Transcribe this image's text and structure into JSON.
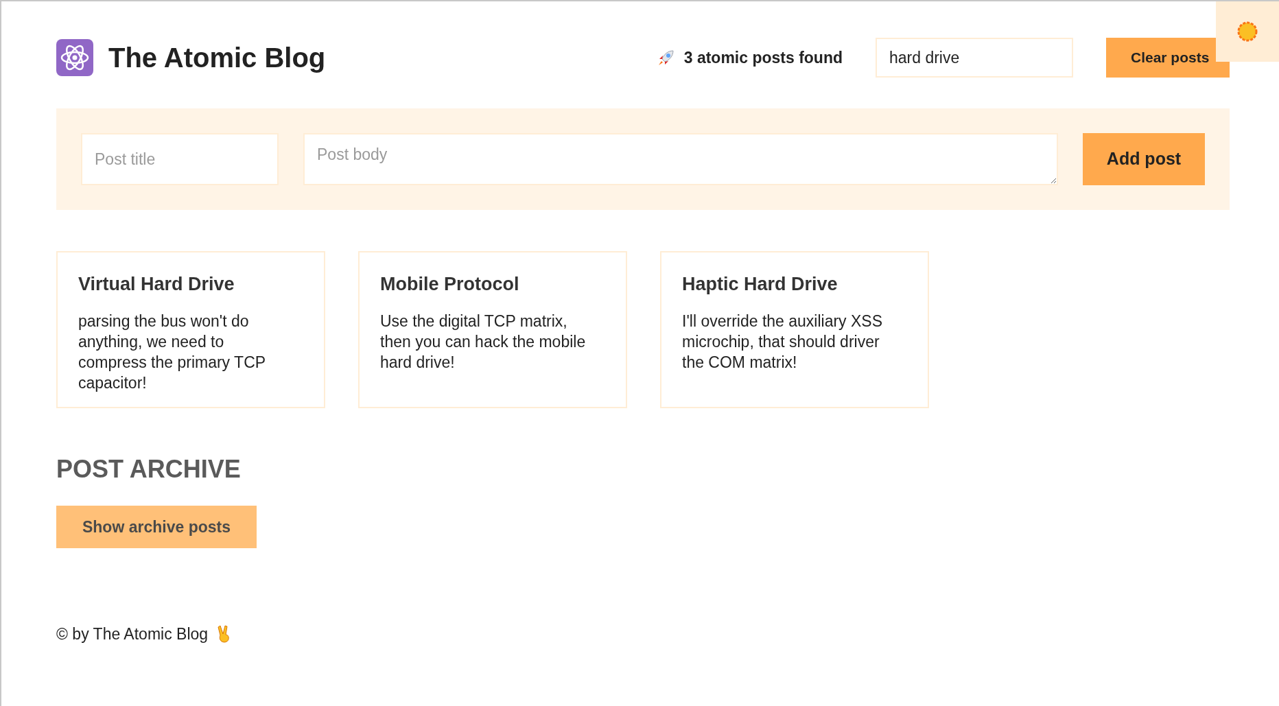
{
  "header": {
    "title": "The Atomic Blog",
    "results": "3 atomic posts found",
    "search": {
      "value": "hard drive"
    },
    "clear_button": "Clear posts"
  },
  "form": {
    "title_field": {
      "placeholder": "Post title"
    },
    "body_field": {
      "placeholder": "Post body"
    },
    "add_button": "Add post"
  },
  "posts": [
    {
      "title": "Virtual Hard Drive",
      "body": "parsing the bus won't do anything, we need to compress the primary TCP capacitor!"
    },
    {
      "title": "Mobile Protocol",
      "body": "Use the digital TCP matrix, then you can hack the mobile hard drive!"
    },
    {
      "title": "Haptic Hard Drive",
      "body": "I'll override the auxiliary XSS microchip, that should driver the COM matrix!"
    }
  ],
  "archive": {
    "heading": "POST ARCHIVE",
    "show_button": "Show archive posts"
  },
  "footer": {
    "text": "© by The Atomic Blog"
  }
}
